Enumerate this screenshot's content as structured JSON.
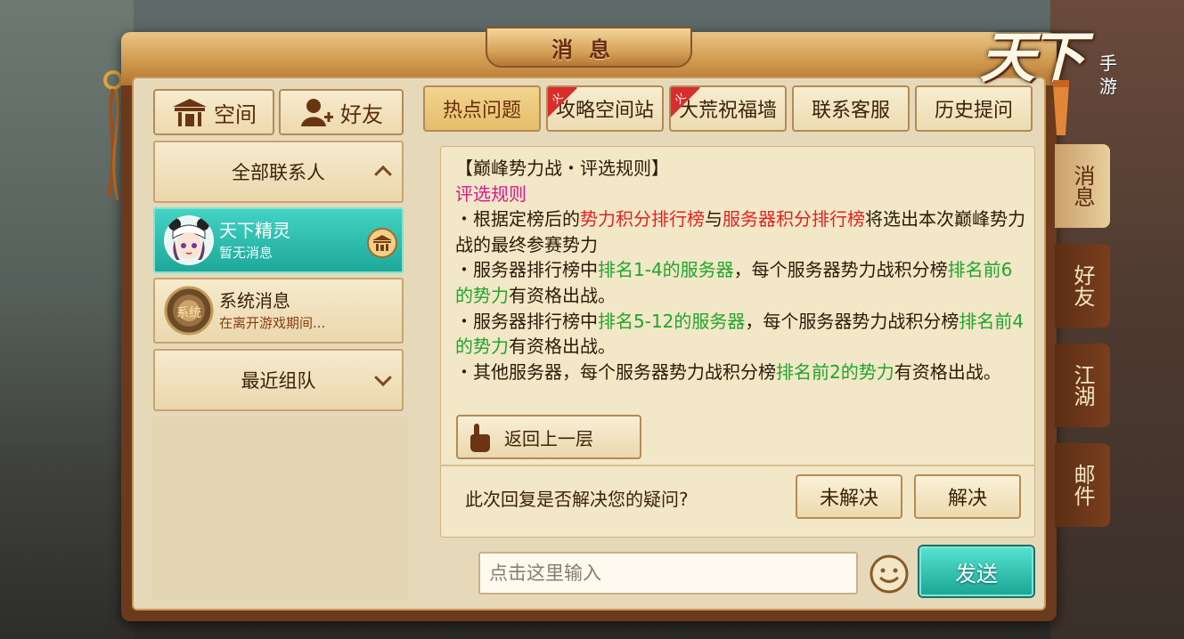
{
  "window": {
    "title": "消息"
  },
  "logo": {
    "main": "天下",
    "sub": "手游"
  },
  "left": {
    "top_buttons": [
      {
        "label": "空间",
        "icon": "pavilion-icon"
      },
      {
        "label": "好友",
        "icon": "add-friend-icon"
      }
    ],
    "all_contacts": {
      "label": "全部联系人",
      "state": "expanded"
    },
    "contacts": [
      {
        "name": "天下精灵",
        "preview": "暂无消息",
        "selected": true
      },
      {
        "name": "系统消息",
        "preview": "在离开游戏期间...",
        "avatar_text": "系统",
        "selected": false
      }
    ],
    "recent_team": {
      "label": "最近组队",
      "state": "collapsed"
    }
  },
  "tabs": [
    {
      "label": "热点问题",
      "active": true,
      "hot": false
    },
    {
      "label": "攻略空间站",
      "active": false,
      "hot": true
    },
    {
      "label": "大荒祝福墙",
      "active": false,
      "hot": true
    },
    {
      "label": "联系客服",
      "active": false,
      "hot": false
    },
    {
      "label": "历史提问",
      "active": false,
      "hot": false
    }
  ],
  "hot_badge": "火",
  "article": {
    "title": "【巅峰势力战・评选规则】",
    "subtitle": "评选规则",
    "p1": {
      "a": "・根据定榜后的",
      "b": "势力积分排行榜",
      "c": "与",
      "d": "服务器积分排行榜",
      "e": "将选出本次巅峰势力战的最终参赛势力"
    },
    "p2": {
      "a": "・服务器排行榜中",
      "b": "排名1-4的服务器",
      "c": "，每个服务器势力战积分榜",
      "d": "排名前6的势力",
      "e": "有资格出战。"
    },
    "p3": {
      "a": "・服务器排行榜中",
      "b": "排名5-12的服务器",
      "c": "，每个服务器势力战积分榜",
      "d": "排名前4的势力",
      "e": "有资格出战。"
    },
    "p4": {
      "a": "・其他服务器，每个服务器势力战积分榜",
      "b": "排名前2的势力",
      "c": "有资格出战。"
    }
  },
  "back_button": "返回上一层",
  "feedback": {
    "question": "此次回复是否解决您的疑问?",
    "unsolved": "未解决",
    "solved": "解决"
  },
  "input": {
    "placeholder": "点击这里输入",
    "value": ""
  },
  "send_button": "发送",
  "side_tabs": [
    {
      "label": "消息",
      "active": true
    },
    {
      "label": "好友",
      "active": false
    },
    {
      "label": "江湖",
      "active": false
    },
    {
      "label": "邮件",
      "active": false
    }
  ],
  "colors": {
    "highlight_pink": "#d6198f",
    "highlight_red": "#e02323",
    "highlight_green": "#1fa52d",
    "selected_teal": "#1ea89a"
  }
}
